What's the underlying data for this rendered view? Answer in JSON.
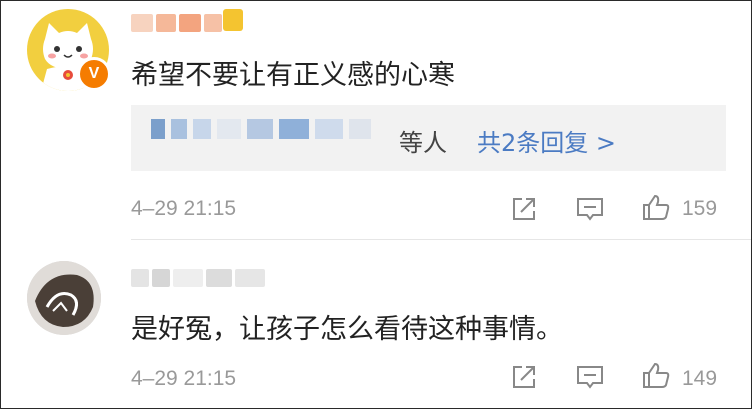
{
  "comments": [
    {
      "text": "希望不要让有正义感的心寒",
      "replies": {
        "suffix": "等人",
        "link": "共2条回复 >"
      },
      "time": "4–29 21:15",
      "likes": "159"
    },
    {
      "text": "是好冤，让孩子怎么看待这种事情。",
      "time": "4–29 21:15",
      "likes": "149"
    }
  ],
  "badge": "V",
  "colors": {
    "text": "#222222",
    "meta": "#999999",
    "link": "#4b7bc3",
    "reply_bg": "#f2f2f2",
    "verified_badge": "#f57c00"
  },
  "icons": [
    "share-icon",
    "comment-icon",
    "like-icon"
  ]
}
